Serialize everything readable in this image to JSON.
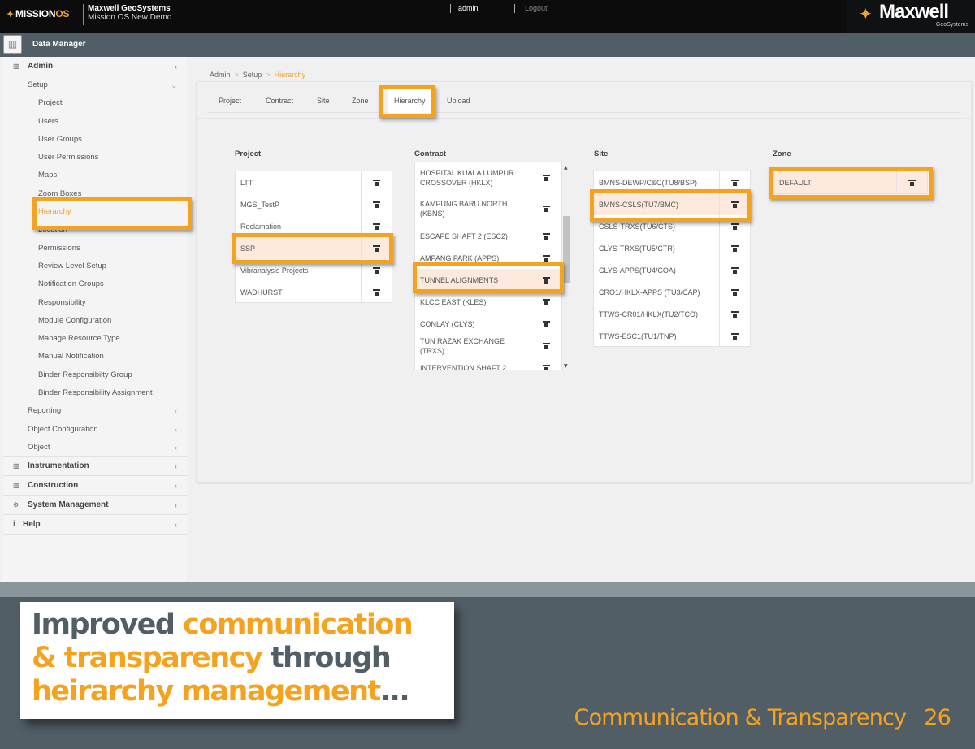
{
  "topbar": {
    "logo_prefix": "MISSION",
    "logo_suffix": "OS",
    "org_name": "Maxwell GeoSystems",
    "org_sub": "Mission OS New Demo",
    "user": "admin",
    "logout": "Logout",
    "brand_name": "Maxwell",
    "brand_sub": "GeoSystems"
  },
  "module": {
    "title": "Data Manager",
    "icon": "bar-chart-icon"
  },
  "sidebar": {
    "admin": "Admin",
    "setup": "Setup",
    "setup_items": [
      "Project",
      "Users",
      "User Groups",
      "User Permissions",
      "Maps",
      "Zoom Boxes",
      "Hierarchy",
      "Location",
      "Permissions",
      "Review Level Setup",
      "Notification Groups",
      "Responsibility",
      "Module Configuration",
      "Manage Resource Type",
      "Manual Notification",
      "Binder Responsibilty Group",
      "Binder Responsibility Assignment"
    ],
    "active_item": "Hierarchy",
    "admin_subs": [
      "Reporting",
      "Object Configuration",
      "Object"
    ],
    "top_sections": [
      {
        "label": "Instrumentation",
        "icon": "bar-chart-icon"
      },
      {
        "label": "Construction",
        "icon": "bar-chart-icon"
      },
      {
        "label": "System Management",
        "icon": "gears-icon"
      },
      {
        "label": "Help",
        "icon": "info-icon"
      }
    ]
  },
  "breadcrumb": [
    "Admin",
    "Setup",
    "Hierarchy"
  ],
  "tabs": [
    "Project",
    "Contract",
    "Site",
    "Zone",
    "Hierarchy",
    "Upload"
  ],
  "active_tab": "Hierarchy",
  "columns": {
    "project": {
      "title": "Project",
      "items": [
        "LTT",
        "MGS_TestP",
        "Reclamation",
        "SSP",
        "Vibranalysis Projects",
        "WADHURST"
      ],
      "selected": "SSP"
    },
    "contract": {
      "title": "Contract",
      "items": [
        "HOSPITAL KUALA LUMPUR CROSSOVER (HKLX)",
        "KAMPUNG BARU NORTH (KBNS)",
        "ESCAPE SHAFT 2 (ESC2)",
        "AMPANG PARK (APPS)",
        "TUNNEL ALIGNMENTS",
        "KLCC EAST (KLES)",
        "CONLAY (CLYS)",
        "TUN RAZAK EXCHANGE (TRXS)",
        "INTERVENTION SHAFT 2"
      ],
      "selected": "TUNNEL ALIGNMENTS"
    },
    "site": {
      "title": "Site",
      "items": [
        "BMNS-DEWP/C&C(TU8/BSP)",
        "BMNS-CSLS(TU7/BMC)",
        "CSLS-TRXS(TU6/CTS)",
        "CLYS-TRXS(TU5/CTR)",
        "CLYS-APPS(TU4/COA)",
        "CRO1/HKLX-APPS (TU3/CAP)",
        "TTWS-CR01/HKLX(TU2/TCO)",
        "TTWS-ESC1(TU1/TNP)"
      ],
      "selected": "BMNS-CSLS(TU7/BMC)"
    },
    "zone": {
      "title": "Zone",
      "items": [
        "DEFAULT"
      ],
      "selected": "DEFAULT"
    }
  },
  "caption": {
    "w1": "Improved ",
    "w2": "communication",
    "w3": "& transparency",
    "w4": " through",
    "w5": "heirarchy management",
    "w6": "..."
  },
  "footer": {
    "title": "Communication & Transparency",
    "page": "26"
  },
  "colors": {
    "accent": "#f4a21f",
    "slate": "#525e66",
    "selected_row": "#fde9dd"
  }
}
